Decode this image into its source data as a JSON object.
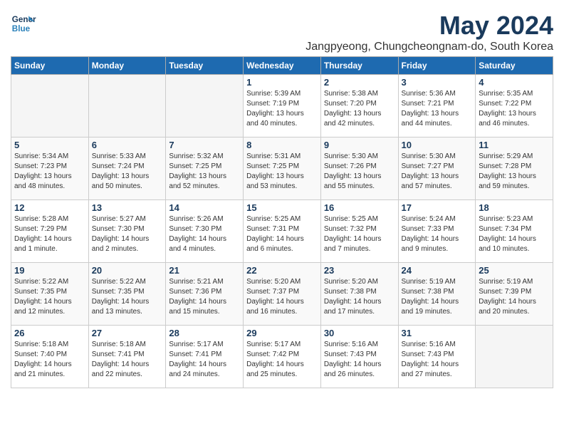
{
  "header": {
    "logo_line1": "General",
    "logo_line2": "Blue",
    "month": "May 2024",
    "location": "Jangpyeong, Chungcheongnam-do, South Korea"
  },
  "days_of_week": [
    "Sunday",
    "Monday",
    "Tuesday",
    "Wednesday",
    "Thursday",
    "Friday",
    "Saturday"
  ],
  "weeks": [
    [
      {
        "num": "",
        "empty": true
      },
      {
        "num": "",
        "empty": true
      },
      {
        "num": "",
        "empty": true
      },
      {
        "num": "1",
        "sunrise": "Sunrise: 5:39 AM",
        "sunset": "Sunset: 7:19 PM",
        "daylight": "Daylight: 13 hours and 40 minutes."
      },
      {
        "num": "2",
        "sunrise": "Sunrise: 5:38 AM",
        "sunset": "Sunset: 7:20 PM",
        "daylight": "Daylight: 13 hours and 42 minutes."
      },
      {
        "num": "3",
        "sunrise": "Sunrise: 5:36 AM",
        "sunset": "Sunset: 7:21 PM",
        "daylight": "Daylight: 13 hours and 44 minutes."
      },
      {
        "num": "4",
        "sunrise": "Sunrise: 5:35 AM",
        "sunset": "Sunset: 7:22 PM",
        "daylight": "Daylight: 13 hours and 46 minutes."
      }
    ],
    [
      {
        "num": "5",
        "sunrise": "Sunrise: 5:34 AM",
        "sunset": "Sunset: 7:23 PM",
        "daylight": "Daylight: 13 hours and 48 minutes."
      },
      {
        "num": "6",
        "sunrise": "Sunrise: 5:33 AM",
        "sunset": "Sunset: 7:24 PM",
        "daylight": "Daylight: 13 hours and 50 minutes."
      },
      {
        "num": "7",
        "sunrise": "Sunrise: 5:32 AM",
        "sunset": "Sunset: 7:25 PM",
        "daylight": "Daylight: 13 hours and 52 minutes."
      },
      {
        "num": "8",
        "sunrise": "Sunrise: 5:31 AM",
        "sunset": "Sunset: 7:25 PM",
        "daylight": "Daylight: 13 hours and 53 minutes."
      },
      {
        "num": "9",
        "sunrise": "Sunrise: 5:30 AM",
        "sunset": "Sunset: 7:26 PM",
        "daylight": "Daylight: 13 hours and 55 minutes."
      },
      {
        "num": "10",
        "sunrise": "Sunrise: 5:30 AM",
        "sunset": "Sunset: 7:27 PM",
        "daylight": "Daylight: 13 hours and 57 minutes."
      },
      {
        "num": "11",
        "sunrise": "Sunrise: 5:29 AM",
        "sunset": "Sunset: 7:28 PM",
        "daylight": "Daylight: 13 hours and 59 minutes."
      }
    ],
    [
      {
        "num": "12",
        "sunrise": "Sunrise: 5:28 AM",
        "sunset": "Sunset: 7:29 PM",
        "daylight": "Daylight: 14 hours and 1 minute."
      },
      {
        "num": "13",
        "sunrise": "Sunrise: 5:27 AM",
        "sunset": "Sunset: 7:30 PM",
        "daylight": "Daylight: 14 hours and 2 minutes."
      },
      {
        "num": "14",
        "sunrise": "Sunrise: 5:26 AM",
        "sunset": "Sunset: 7:30 PM",
        "daylight": "Daylight: 14 hours and 4 minutes."
      },
      {
        "num": "15",
        "sunrise": "Sunrise: 5:25 AM",
        "sunset": "Sunset: 7:31 PM",
        "daylight": "Daylight: 14 hours and 6 minutes."
      },
      {
        "num": "16",
        "sunrise": "Sunrise: 5:25 AM",
        "sunset": "Sunset: 7:32 PM",
        "daylight": "Daylight: 14 hours and 7 minutes."
      },
      {
        "num": "17",
        "sunrise": "Sunrise: 5:24 AM",
        "sunset": "Sunset: 7:33 PM",
        "daylight": "Daylight: 14 hours and 9 minutes."
      },
      {
        "num": "18",
        "sunrise": "Sunrise: 5:23 AM",
        "sunset": "Sunset: 7:34 PM",
        "daylight": "Daylight: 14 hours and 10 minutes."
      }
    ],
    [
      {
        "num": "19",
        "sunrise": "Sunrise: 5:22 AM",
        "sunset": "Sunset: 7:35 PM",
        "daylight": "Daylight: 14 hours and 12 minutes."
      },
      {
        "num": "20",
        "sunrise": "Sunrise: 5:22 AM",
        "sunset": "Sunset: 7:35 PM",
        "daylight": "Daylight: 14 hours and 13 minutes."
      },
      {
        "num": "21",
        "sunrise": "Sunrise: 5:21 AM",
        "sunset": "Sunset: 7:36 PM",
        "daylight": "Daylight: 14 hours and 15 minutes."
      },
      {
        "num": "22",
        "sunrise": "Sunrise: 5:20 AM",
        "sunset": "Sunset: 7:37 PM",
        "daylight": "Daylight: 14 hours and 16 minutes."
      },
      {
        "num": "23",
        "sunrise": "Sunrise: 5:20 AM",
        "sunset": "Sunset: 7:38 PM",
        "daylight": "Daylight: 14 hours and 17 minutes."
      },
      {
        "num": "24",
        "sunrise": "Sunrise: 5:19 AM",
        "sunset": "Sunset: 7:38 PM",
        "daylight": "Daylight: 14 hours and 19 minutes."
      },
      {
        "num": "25",
        "sunrise": "Sunrise: 5:19 AM",
        "sunset": "Sunset: 7:39 PM",
        "daylight": "Daylight: 14 hours and 20 minutes."
      }
    ],
    [
      {
        "num": "26",
        "sunrise": "Sunrise: 5:18 AM",
        "sunset": "Sunset: 7:40 PM",
        "daylight": "Daylight: 14 hours and 21 minutes."
      },
      {
        "num": "27",
        "sunrise": "Sunrise: 5:18 AM",
        "sunset": "Sunset: 7:41 PM",
        "daylight": "Daylight: 14 hours and 22 minutes."
      },
      {
        "num": "28",
        "sunrise": "Sunrise: 5:17 AM",
        "sunset": "Sunset: 7:41 PM",
        "daylight": "Daylight: 14 hours and 24 minutes."
      },
      {
        "num": "29",
        "sunrise": "Sunrise: 5:17 AM",
        "sunset": "Sunset: 7:42 PM",
        "daylight": "Daylight: 14 hours and 25 minutes."
      },
      {
        "num": "30",
        "sunrise": "Sunrise: 5:16 AM",
        "sunset": "Sunset: 7:43 PM",
        "daylight": "Daylight: 14 hours and 26 minutes."
      },
      {
        "num": "31",
        "sunrise": "Sunrise: 5:16 AM",
        "sunset": "Sunset: 7:43 PM",
        "daylight": "Daylight: 14 hours and 27 minutes."
      },
      {
        "num": "",
        "empty": true
      }
    ]
  ]
}
